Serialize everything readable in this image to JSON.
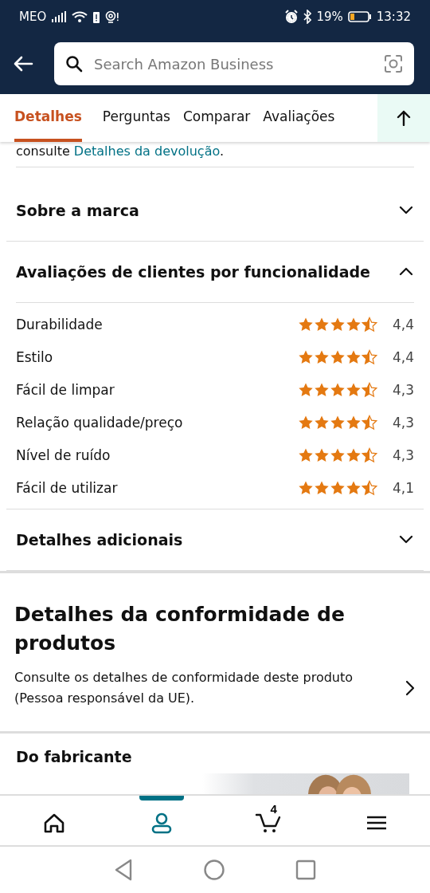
{
  "status_bar": {
    "carrier": "MEO",
    "battery_percent": "19%",
    "time": "13:32"
  },
  "search": {
    "placeholder": "Search Amazon Business"
  },
  "tabs": [
    {
      "label": "Detalhes",
      "selected": true
    },
    {
      "label": "Perguntas",
      "selected": false
    },
    {
      "label": "Comparar",
      "selected": false
    },
    {
      "label": "Avaliações",
      "selected": false
    }
  ],
  "partial_text": "consulte **Detalhes da devolução**.",
  "sections": [
    {
      "title": "Sobre a marca",
      "expanded": false
    },
    {
      "title": "Avaliações de clientes por funcionalidade",
      "expanded": true,
      "ratings": [
        {
          "feature": "Durabilidade",
          "stars": 4.5,
          "score": "4,4"
        },
        {
          "feature": "Estilo",
          "stars": 4.5,
          "score": "4,4"
        },
        {
          "feature": "Fácil de limpar",
          "stars": 4.5,
          "score": "4,3"
        },
        {
          "feature": "Relação qualidade/preço",
          "stars": 4.5,
          "score": "4,3"
        },
        {
          "feature": "Nível de ruído",
          "stars": 4.5,
          "score": "4,3"
        },
        {
          "feature": "Fácil de utilizar",
          "stars": 4.5,
          "score": "4,1"
        }
      ]
    },
    {
      "title": "Detalhes adicionais",
      "expanded": false
    }
  ],
  "compliance": {
    "title": "Detalhes da conformidade de produtos",
    "text": "Consulte os detalhes de conformidade deste produto (Pessoa responsável da UE)."
  },
  "manufacturer": {
    "title": "Do fabricante"
  },
  "bottom_nav": [
    {
      "kind": "home",
      "selected": false
    },
    {
      "kind": "account",
      "selected": true
    },
    {
      "kind": "cart",
      "selected": false,
      "badge": "4"
    },
    {
      "kind": "menu",
      "selected": false
    }
  ]
}
